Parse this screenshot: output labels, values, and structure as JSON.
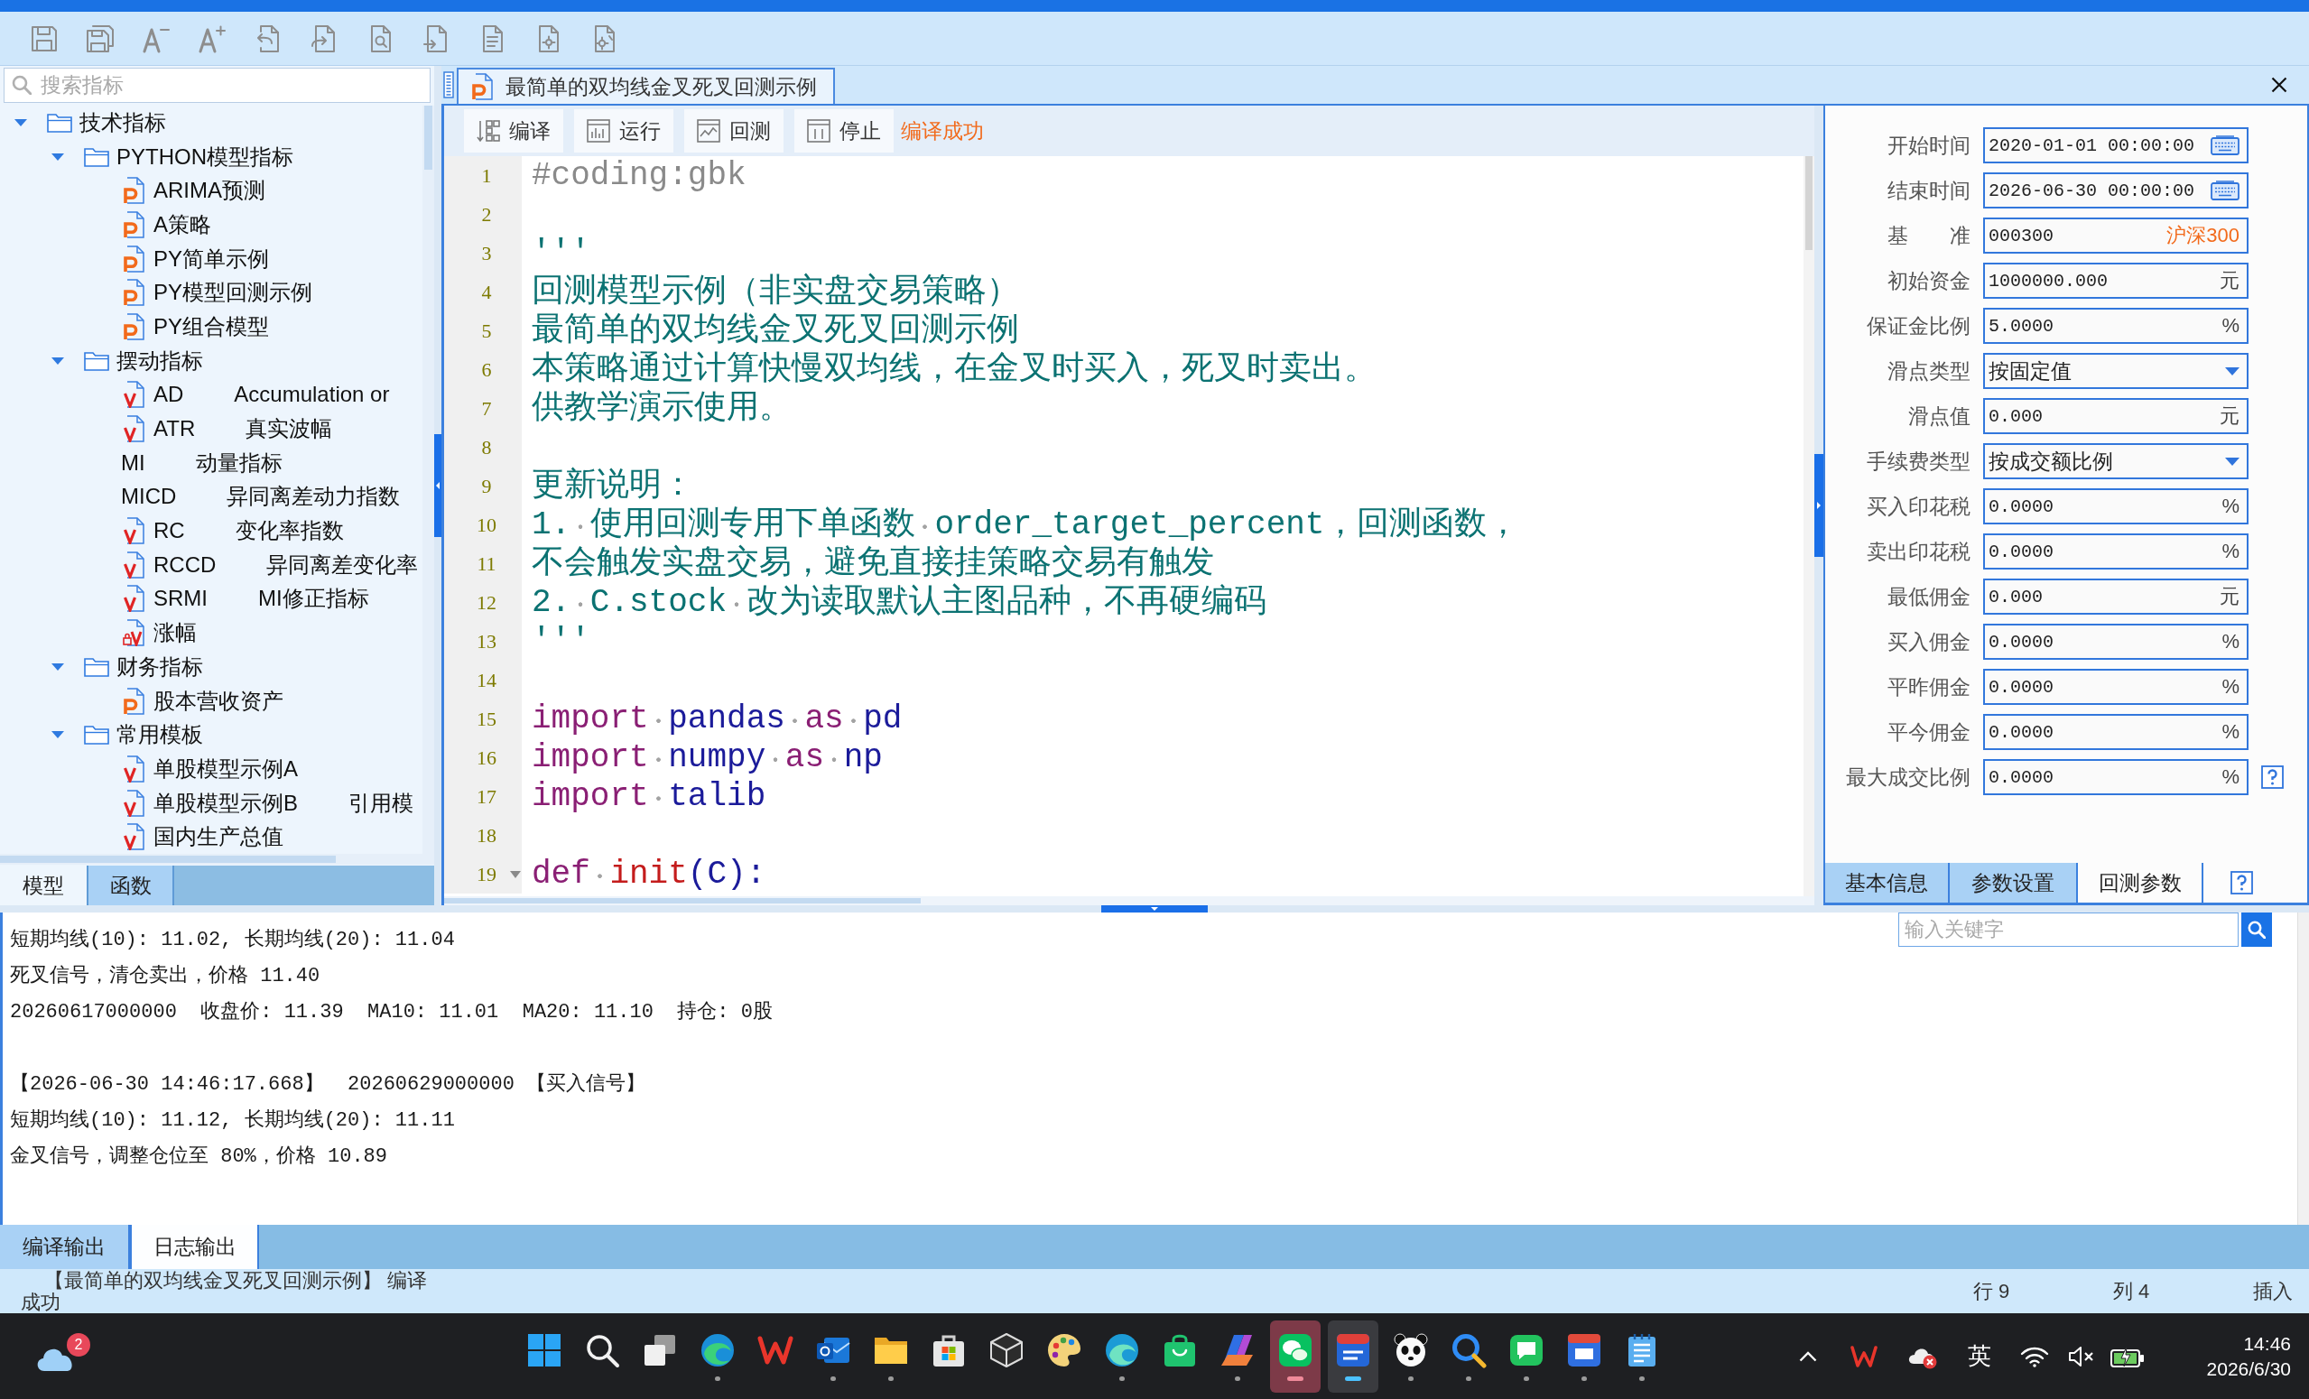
{
  "indicator_panel": {
    "search": {
      "placeholder": "搜索指标"
    },
    "tree": [
      {
        "label": "技术指标",
        "expanded": true,
        "children": [
          {
            "label": "PYTHON模型指标",
            "expanded": true,
            "children": [
              {
                "label": "ARIMA预测",
                "kind": "python"
              },
              {
                "label": "A策略",
                "kind": "python"
              },
              {
                "label": "PY简单示例",
                "kind": "python"
              },
              {
                "label": "PY模型回测示例",
                "kind": "python"
              },
              {
                "label": "PY组合模型",
                "kind": "python"
              }
            ]
          },
          {
            "label": "摆动指标",
            "expanded": true,
            "children": [
              {
                "label": "AD",
                "description": "Accumulation or",
                "kind": "formula"
              },
              {
                "label": "ATR",
                "description": "真实波幅",
                "kind": "formula"
              },
              {
                "label": "MI",
                "description": "动量指标",
                "kind": "plain"
              },
              {
                "label": "MICD",
                "description": "异同离差动力指数",
                "kind": "plain"
              },
              {
                "label": "RC",
                "description": "变化率指数",
                "kind": "formula"
              },
              {
                "label": "RCCD",
                "description": "异同离差变化率",
                "kind": "formula"
              },
              {
                "label": "SRMI",
                "description": "MI修正指标",
                "kind": "formula"
              },
              {
                "label": "涨幅",
                "kind": "locked-formula"
              }
            ]
          },
          {
            "label": "财务指标",
            "expanded": true,
            "children": [
              {
                "label": "股本营收资产",
                "kind": "python"
              }
            ]
          },
          {
            "label": "常用模板",
            "expanded": true,
            "children": [
              {
                "label": "单股模型示例A",
                "kind": "formula"
              },
              {
                "label": "单股模型示例B",
                "description": "引用模",
                "kind": "formula"
              },
              {
                "label": "国内生产总值",
                "kind": "formula"
              }
            ]
          }
        ]
      }
    ],
    "tabs": [
      {
        "label": "模型",
        "selected": true
      },
      {
        "label": "函数",
        "selected": false
      }
    ]
  },
  "editor": {
    "tab": {
      "title": "最简单的双均线金叉死叉回测示例"
    },
    "toolbar": [
      {
        "label": "编译",
        "kind": "compile"
      },
      {
        "label": "运行",
        "kind": "run"
      },
      {
        "label": "回测",
        "kind": "backtest"
      },
      {
        "label": "停止",
        "kind": "stop"
      }
    ],
    "status": "编译成功",
    "lines": [
      {
        "number": "1",
        "foldable": false,
        "segments": [
          {
            "text": "#coding:gbk",
            "kind": "comment"
          }
        ]
      },
      {
        "number": "2",
        "foldable": false
      },
      {
        "number": "3",
        "foldable": false,
        "segments": [
          {
            "text": "'''",
            "kind": "docstring"
          }
        ]
      },
      {
        "number": "4",
        "foldable": false,
        "segments": [
          {
            "text": "回测模型示例（非实盘交易策略）",
            "kind": "docstring"
          }
        ]
      },
      {
        "number": "5",
        "foldable": false,
        "segments": [
          {
            "text": "最简单的双均线金叉死叉回测示例",
            "kind": "docstring"
          }
        ]
      },
      {
        "number": "6",
        "foldable": false,
        "segments": [
          {
            "text": "本策略通过计算快慢双均线，在金叉时买入，死叉时卖出。",
            "kind": "docstring"
          }
        ]
      },
      {
        "number": "7",
        "foldable": false,
        "segments": [
          {
            "text": "供教学演示使用。",
            "kind": "docstring"
          }
        ]
      },
      {
        "number": "8",
        "foldable": false
      },
      {
        "number": "9",
        "foldable": false,
        "segments": [
          {
            "text": "更新说明：",
            "kind": "docstring"
          }
        ]
      },
      {
        "number": "10",
        "foldable": false,
        "segments": [
          {
            "text": "1. 使用回测专用下单函数 order_target_percent，回测函数，",
            "kind": "docstring"
          }
        ]
      },
      {
        "number": "11",
        "foldable": false,
        "segments": [
          {
            "text": "不会触发实盘交易，避免直接挂策略交易有触发",
            "kind": "docstring"
          }
        ]
      },
      {
        "number": "12",
        "foldable": false,
        "segments": [
          {
            "text": "2. C.stock 改为读取默认主图品种，不再硬编码",
            "kind": "docstring"
          }
        ]
      },
      {
        "number": "13",
        "foldable": false,
        "segments": [
          {
            "text": "'''",
            "kind": "docstring"
          }
        ]
      },
      {
        "number": "14",
        "foldable": false
      },
      {
        "number": "15",
        "foldable": false,
        "segments": [
          {
            "text": "import ",
            "kind": "keyword"
          },
          {
            "text": "pandas ",
            "kind": "name"
          },
          {
            "text": "as ",
            "kind": "keyword"
          },
          {
            "text": "pd",
            "kind": "name"
          }
        ]
      },
      {
        "number": "16",
        "foldable": false,
        "segments": [
          {
            "text": "import ",
            "kind": "keyword"
          },
          {
            "text": "numpy ",
            "kind": "name"
          },
          {
            "text": "as ",
            "kind": "keyword"
          },
          {
            "text": "np",
            "kind": "name"
          }
        ]
      },
      {
        "number": "17",
        "foldable": false,
        "segments": [
          {
            "text": "import ",
            "kind": "keyword"
          },
          {
            "text": "talib",
            "kind": "name"
          }
        ]
      },
      {
        "number": "18",
        "foldable": false
      },
      {
        "number": "19",
        "foldable": true,
        "segments": [
          {
            "text": "def ",
            "kind": "keyword"
          },
          {
            "text": "init",
            "kind": "function"
          },
          {
            "text": "(C):",
            "kind": "name"
          }
        ]
      }
    ]
  },
  "backtest_params": {
    "fields": [
      {
        "label": "开始时间",
        "value": "2020-01-01 00:00:00",
        "kind": "datetime",
        "help": false
      },
      {
        "label": "结束时间",
        "value": "2026-06-30 00:00:00",
        "kind": "datetime",
        "help": false
      },
      {
        "label": "基　　准",
        "value": "000300",
        "suffix": "沪深300",
        "kind": "benchmark",
        "help": false
      },
      {
        "label": "初始资金",
        "value": "1000000.000",
        "suffix": "元",
        "kind": "number",
        "help": false
      },
      {
        "label": "保证金比例",
        "value": "5.0000",
        "suffix": "%",
        "kind": "number",
        "help": false
      },
      {
        "label": "滑点类型",
        "value": "按固定值",
        "kind": "select",
        "help": false
      },
      {
        "label": "滑点值",
        "value": "0.000",
        "suffix": "元",
        "kind": "number",
        "help": false
      },
      {
        "label": "手续费类型",
        "value": "按成交额比例",
        "kind": "select",
        "help": false
      },
      {
        "label": "买入印花税",
        "value": "0.0000",
        "suffix": "%",
        "kind": "number",
        "help": false
      },
      {
        "label": "卖出印花税",
        "value": "0.0000",
        "suffix": "%",
        "kind": "number",
        "help": false
      },
      {
        "label": "最低佣金",
        "value": "0.000",
        "suffix": "元",
        "kind": "number",
        "help": false
      },
      {
        "label": "买入佣金",
        "value": "0.0000",
        "suffix": "%",
        "kind": "number",
        "help": false
      },
      {
        "label": "平昨佣金",
        "value": "0.0000",
        "suffix": "%",
        "kind": "number",
        "help": false
      },
      {
        "label": "平今佣金",
        "value": "0.0000",
        "suffix": "%",
        "kind": "number",
        "help": false
      },
      {
        "label": "最大成交比例",
        "value": "0.0000",
        "suffix": "%",
        "kind": "number",
        "help": true
      }
    ],
    "tabs": [
      {
        "label": "基本信息",
        "selected": false
      },
      {
        "label": "参数设置",
        "selected": false
      },
      {
        "label": "回测参数",
        "selected": true
      }
    ]
  },
  "output": {
    "search": {
      "placeholder": "输入关键字"
    },
    "log": [
      {
        "lines": [
          "短期均线(10): 11.02, 长期均线(20): 11.04",
          "死叉信号，清仓卖出，价格 11.40",
          "20260617000000  收盘价: 11.39  MA10: 11.01  MA20: 11.10  持仓: 0股"
        ]
      },
      {
        "lines": [
          "【2026-06-30 14:46:17.668】  20260629000000 【买入信号】",
          "短期均线(10): 11.12, 长期均线(20): 11.11",
          "金叉信号，调整仓位至 80%，价格 10.89"
        ]
      }
    ],
    "tabs": [
      {
        "label": "编译输出",
        "selected": false
      },
      {
        "label": "日志输出",
        "selected": true
      }
    ]
  },
  "status_bar": {
    "message": "【最简单的双均线金叉死叉回测示例】 编译成功",
    "line": "行 9",
    "column": "列 4",
    "mode": "插入"
  },
  "taskbar": {
    "weather_badge": "2",
    "apps": [
      {
        "kind": "start",
        "running": false,
        "selected": false,
        "attention": false
      },
      {
        "kind": "search",
        "running": false,
        "selected": false,
        "attention": false
      },
      {
        "kind": "taskview",
        "running": false,
        "selected": false,
        "attention": false
      },
      {
        "kind": "browser",
        "running": true,
        "selected": false,
        "attention": false
      },
      {
        "kind": "office",
        "running": false,
        "selected": false,
        "attention": false
      },
      {
        "kind": "mail",
        "running": true,
        "selected": false,
        "attention": false
      },
      {
        "kind": "files",
        "running": true,
        "selected": false,
        "attention": false
      },
      {
        "kind": "store",
        "running": false,
        "selected": false,
        "attention": false
      },
      {
        "kind": "cube",
        "running": false,
        "selected": false,
        "attention": false
      },
      {
        "kind": "paint",
        "running": false,
        "selected": false,
        "attention": false
      },
      {
        "kind": "devbrowser",
        "running": true,
        "selected": false,
        "attention": false
      },
      {
        "kind": "shop",
        "running": false,
        "selected": false,
        "attention": false
      },
      {
        "kind": "suite",
        "running": true,
        "selected": false,
        "attention": false
      },
      {
        "kind": "chat",
        "running": true,
        "selected": false,
        "attention": true
      },
      {
        "kind": "trading",
        "running": true,
        "selected": true,
        "attention": false
      },
      {
        "kind": "panda",
        "running": true,
        "selected": false,
        "attention": false
      },
      {
        "kind": "finder",
        "running": true,
        "selected": false,
        "attention": false
      },
      {
        "kind": "messenger",
        "running": true,
        "selected": false,
        "attention": false
      },
      {
        "kind": "tool",
        "running": true,
        "selected": false,
        "attention": false
      },
      {
        "kind": "notes",
        "running": true,
        "selected": false,
        "attention": false
      }
    ],
    "ime": "英",
    "time": "14:46",
    "date": "2026/6/30"
  }
}
